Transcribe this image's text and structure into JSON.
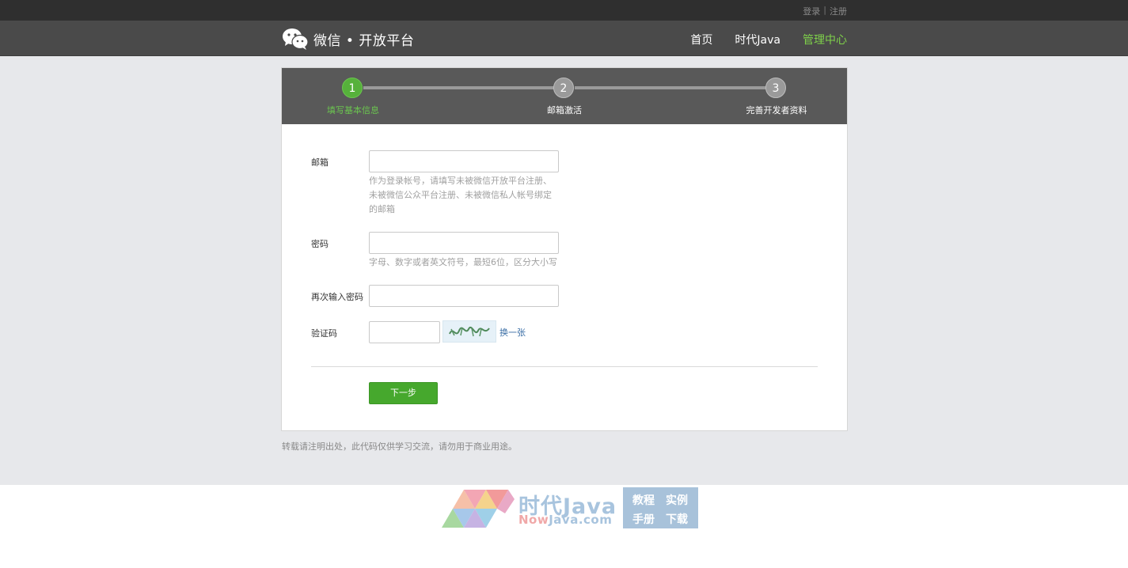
{
  "topbar": {
    "login": "登录",
    "separator": "|",
    "register": "注册"
  },
  "header": {
    "brand_title": "微信 • 开放平台",
    "nav": [
      {
        "label": "首页",
        "active": false
      },
      {
        "label": "时代Java",
        "active": false
      },
      {
        "label": "管理中心",
        "active": true
      }
    ]
  },
  "steps": [
    {
      "number": "1",
      "label": "填写基本信息",
      "active": true
    },
    {
      "number": "2",
      "label": "邮箱激活",
      "active": false
    },
    {
      "number": "3",
      "label": "完善开发者资料",
      "active": false
    }
  ],
  "form": {
    "email_label": "邮箱",
    "email_value": "",
    "email_hint": "作为登录帐号，请填写未被微信开放平台注册、未被微信公众平台注册、未被微信私人帐号绑定的邮箱",
    "password_label": "密码",
    "password_value": "",
    "password_hint": "字母、数字或者英文符号，最短6位，区分大小写",
    "confirm_label": "再次输入密码",
    "confirm_value": "",
    "captcha_label": "验证码",
    "captcha_value": "",
    "captcha_change": "换一张",
    "next_button": "下一步"
  },
  "footer_note": "转载请注明出处，此代码仅供学习交流，请勿用于商业用途。",
  "watermark": {
    "title": "时代Java",
    "url_prefix": "Now",
    "url_rest": "Java.com",
    "box_items": [
      "教程",
      "实例",
      "手册",
      "下载"
    ]
  },
  "colors": {
    "accent_green": "#56b13b",
    "nav_active": "#7fd14a",
    "button_green": "#46a82d",
    "link_blue": "#3a6ea5"
  }
}
